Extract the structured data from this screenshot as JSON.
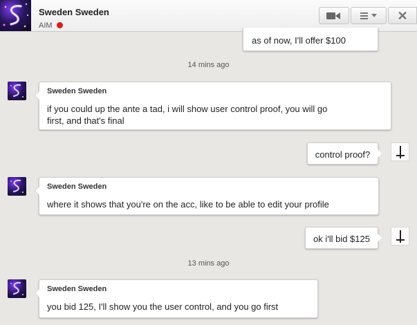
{
  "header": {
    "title": "Sweden Sweden",
    "status_text": "AIM",
    "status_color": "#d42020",
    "avatar_icon": "purple-s-logo",
    "buttons": [
      {
        "name": "video-call-button",
        "icon": "video-camera-icon"
      },
      {
        "name": "options-menu-button",
        "icon": "list-icon"
      },
      {
        "name": "close-button",
        "icon": "close-icon",
        "glyph": "✕"
      }
    ]
  },
  "messages": {
    "m0_text": "as of now, I'll offer $100",
    "ts1": "14 mins ago",
    "m1_sender": "Sweden Sweden",
    "m1_line1": "if you could up the ante a tad, i will show user control proof, you will go",
    "m1_line2": "first, and that's final",
    "m2_text": "control proof?",
    "m3_sender": "Sweden Sweden",
    "m3_text": "where it shows that you're on the acc, like to be able to edit your profile",
    "m4_text": "ok i'll bid $125",
    "ts2": "13 mins ago",
    "m5_sender": "Sweden Sweden",
    "m5_text": "you bid 125, I'll show you the user control, and you go first"
  },
  "colors": {
    "background": "#e9e7e3",
    "bubble": "#ffffff",
    "status_offline": "#d42020"
  }
}
